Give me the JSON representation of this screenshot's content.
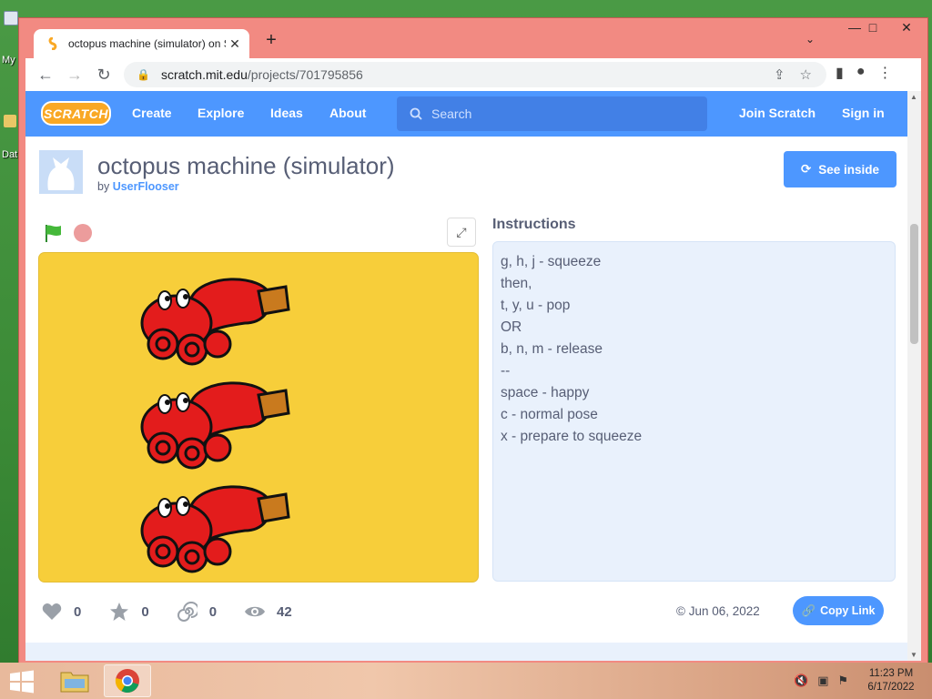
{
  "desktop": {
    "icon_labels": [
      "My",
      "Dat"
    ]
  },
  "browser": {
    "tab_title": "octopus machine (simulator) on S",
    "url_host": "scratch.mit.edu",
    "url_path": "/projects/701795856",
    "new_tab": "+",
    "close_tab": "✕",
    "min": "—",
    "max": "□",
    "close": "✕"
  },
  "scratch_nav": {
    "logo": "SCRATCH",
    "links": [
      "Create",
      "Explore",
      "Ideas",
      "About"
    ],
    "search_placeholder": "Search",
    "join": "Join Scratch",
    "sign_in": "Sign in"
  },
  "project": {
    "title": "octopus machine (simulator)",
    "by_prefix": "by",
    "author": "UserFlooser",
    "see_inside": "See inside",
    "instructions_heading": "Instructions",
    "instructions": [
      "g, h, j - squeeze",
      "then,",
      "t, y, u - pop",
      "OR",
      "b, n, m - release",
      "--",
      "space - happy",
      "c - normal pose",
      "x - prepare to squeeze"
    ],
    "stats": {
      "loves": "0",
      "favorites": "0",
      "remixes": "0",
      "views": "42"
    },
    "shared_date": "© Jun 06, 2022",
    "copy_link": "Copy Link"
  },
  "taskbar": {
    "time": "11:23 PM",
    "date": "6/17/2022"
  },
  "colors": {
    "scratch_blue": "#4d97ff",
    "stage_yellow": "#f7ce3a",
    "octopus_red": "#e31c1c",
    "window_frame": "#f28a82"
  }
}
